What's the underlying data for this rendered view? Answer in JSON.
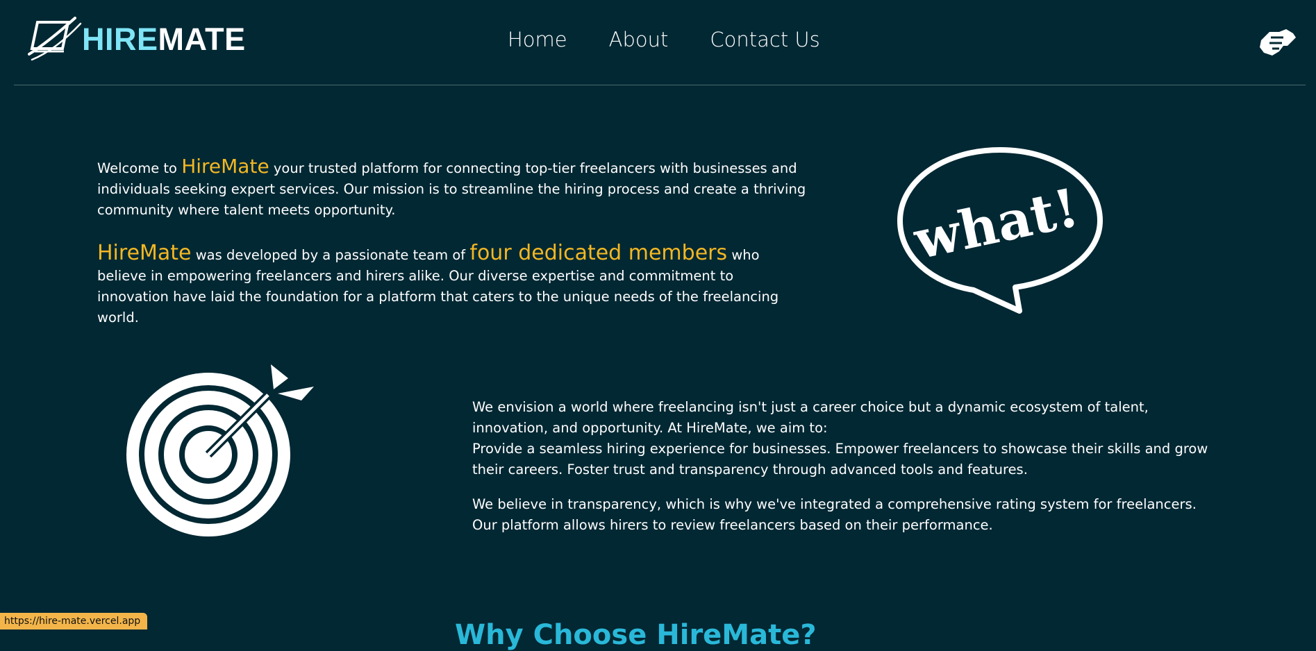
{
  "header": {
    "brand_hire": "HIRE",
    "brand_mate": "MATE",
    "nav": [
      "Home",
      "About",
      "Contact Us"
    ]
  },
  "intro": {
    "p1_before": "Welcome to",
    "p1_brand": "HireMate",
    "p1_after": "your trusted platform for connecting top-tier freelancers with businesses and individuals seeking expert services. Our mission is to streamline the hiring process and create a thriving community where talent meets opportunity.",
    "p2_brand": "HireMate",
    "p2_mid": "was developed by a passionate team of",
    "p2_highlight": "four dedicated members",
    "p2_after": "who believe in empowering freelancers and hirers alike. Our diverse expertise and commitment to innovation have laid the foundation for a platform that caters to the unique needs of the freelancing world."
  },
  "vision": {
    "p1": "We envision a world where freelancing isn't just a career choice but a dynamic ecosystem of talent, innovation, and opportunity. At HireMate, we aim to:",
    "p1b": "Provide a seamless hiring experience for businesses. Empower freelancers to showcase their skills and grow their careers. Foster trust and transparency through advanced tools and features.",
    "p2": "We believe in transparency, which is why we've integrated a comprehensive rating system for freelancers. Our platform allows hirers to review freelancers based on their performance."
  },
  "speech_bubble_text": "what!",
  "bottom_title": "Why Choose HireMate?",
  "status_bar_url": "https://hire-mate.vercel.app",
  "icons": {
    "logo": "laptop-swoosh-icon",
    "handshake": "handshake-icon",
    "speech": "speech-bubble-icon",
    "target": "target-arrow-icon"
  },
  "colors": {
    "background": "#022833",
    "accent_gold": "#f3b724",
    "accent_cyan": "#7fe4f6",
    "title_blue": "#2ab8d9"
  }
}
